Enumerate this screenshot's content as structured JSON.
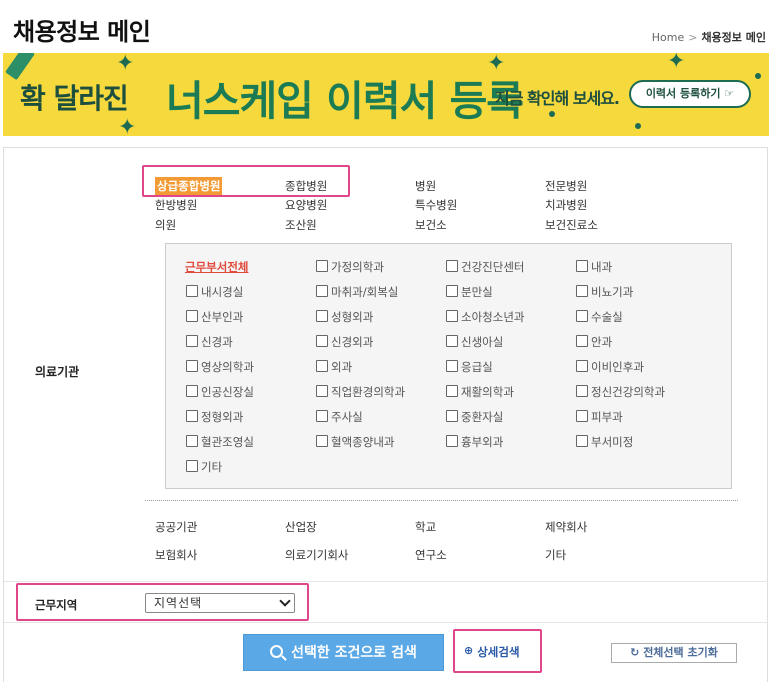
{
  "page": {
    "title": "채용정보 메인"
  },
  "breadcrumb": {
    "home": "Home",
    "sep": ">",
    "current": "채용정보 메인"
  },
  "banner": {
    "part1": "확 달라진",
    "part2": "너스케입 이력서 등록",
    "part3": "지금 확인해 보세요.",
    "button": "이력서 등록하기 ☞",
    "colors": {
      "bg": "#f6d93d",
      "green": "#1a7b55"
    }
  },
  "filters": {
    "institution_label": "의료기관",
    "hospitals": [
      "상급종합병원",
      "종합병원",
      "병원",
      "전문병원",
      "한방병원",
      "요양병원",
      "특수병원",
      "치과병원",
      "의원",
      "조산원",
      "보건소",
      "보건진료소"
    ],
    "departments_all": "근무부서전체",
    "departments": [
      "가정의학과",
      "건강진단센터",
      "내과",
      "내시경실",
      "마취과/회복실",
      "분만실",
      "비뇨기과",
      "산부인과",
      "성형외과",
      "소아청소년과",
      "수술실",
      "신경과",
      "신경외과",
      "신생아실",
      "안과",
      "영상의학과",
      "외과",
      "응급실",
      "이비인후과",
      "인공신장실",
      "직업환경의학과",
      "재활의학과",
      "정신건강의학과",
      "정형외과",
      "주사실",
      "중환자실",
      "피부과",
      "혈관조영실",
      "혈액종양내과",
      "흉부외과",
      "부서미정",
      "기타"
    ],
    "others": [
      "공공기관",
      "산업장",
      "학교",
      "제약회사",
      "보험회사",
      "의료기기회사",
      "연구소",
      "기타"
    ],
    "region_label": "근무지역",
    "region_select": "지역선택"
  },
  "actions": {
    "search": "선택한 조건으로 검색",
    "detail": "상세검색",
    "reset": "전체선택 초기화"
  }
}
